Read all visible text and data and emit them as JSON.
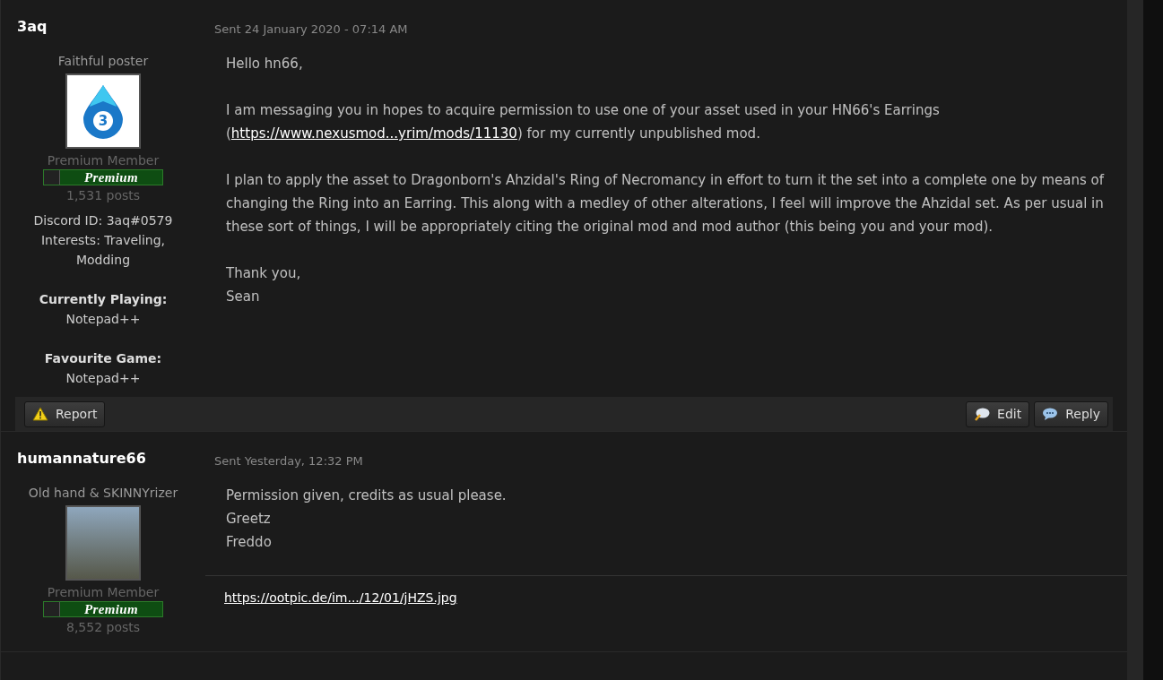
{
  "messages": [
    {
      "author": "3aq",
      "sent": "Sent 24 January 2020 - 07:14 AM",
      "user_title": "Faithful poster",
      "avatar": {
        "kind": "logo",
        "glyph": "3"
      },
      "member_group": "Premium Member",
      "badge": "Premium",
      "posts": "1,531 posts",
      "profile_fields": [
        {
          "kind": "inline",
          "text": "Discord ID: 3aq#0579"
        },
        {
          "kind": "inline",
          "text": "Interests: Traveling, Modding"
        },
        {
          "kind": "block",
          "label": "Currently Playing:",
          "value": "Notepad++"
        },
        {
          "kind": "block",
          "label": "Favourite Game:",
          "value": "Notepad++"
        }
      ],
      "body": [
        [
          [
            {
              "kind": "text",
              "text": "Hello hn66,"
            }
          ]
        ],
        [
          [
            {
              "kind": "text",
              "text": "I am messaging you in hopes to acquire permission to use one of your asset used in your HN66's Earrings ("
            },
            {
              "kind": "link",
              "text": "https://www.nexusmod...yrim/mods/11130"
            },
            {
              "kind": "text",
              "text": ") for my currently unpublished mod."
            }
          ]
        ],
        [
          [
            {
              "kind": "text",
              "text": "I plan to apply the asset to Dragonborn's Ahzidal's Ring of Necromancy in effort to turn it the set into a complete one by means of changing the Ring into an Earring. This along with a medley of other alterations, I feel will improve the Ahzidal set. As per usual in these sort of things, I will be appropriately citing the original mod and mod author (this being you and your mod)."
            }
          ]
        ],
        [
          [
            {
              "kind": "text",
              "text": "Thank you,"
            }
          ],
          [
            {
              "kind": "text",
              "text": "Sean"
            }
          ]
        ]
      ],
      "left_actions": [
        {
          "kind": "report",
          "label": "Report"
        }
      ],
      "right_actions": [
        {
          "kind": "edit",
          "label": "Edit"
        },
        {
          "kind": "reply",
          "label": "Reply"
        }
      ]
    },
    {
      "author": "humannature66",
      "sent": "Sent Yesterday, 12:32 PM",
      "user_title": "Old hand & SKINNYrizer",
      "avatar": {
        "kind": "photo"
      },
      "member_group": "Premium Member",
      "badge": "Premium",
      "posts": "8,552 posts",
      "body": [
        [
          [
            {
              "kind": "text",
              "text": "Permission given, credits as usual please."
            }
          ],
          [
            {
              "kind": "text",
              "text": "Greetz"
            }
          ],
          [
            {
              "kind": "text",
              "text": "Freddo"
            }
          ]
        ]
      ],
      "signature_link": "https://ootpic.de/im.../12/01/jHZS.jpg"
    }
  ]
}
